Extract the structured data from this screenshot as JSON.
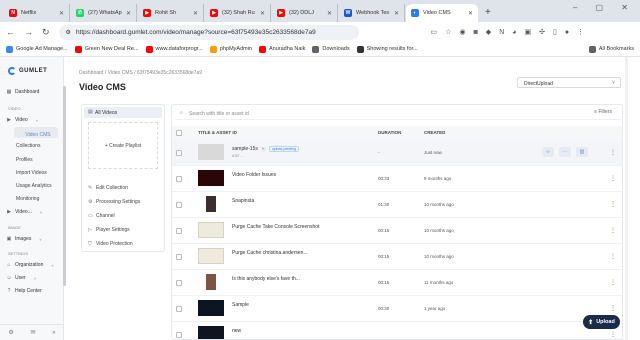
{
  "browser": {
    "tabs": [
      {
        "title": "Netflix",
        "fav_color": "#e50914",
        "glyph": "N"
      },
      {
        "title": "(27) WhatsAp",
        "fav_color": "#25d366",
        "glyph": "✆"
      },
      {
        "title": "Rohit Sh",
        "fav_color": "#ff0000",
        "glyph": "▶"
      },
      {
        "title": "(32) Shah Ru",
        "fav_color": "#ff0000",
        "glyph": "▶"
      },
      {
        "title": "(32) DDLJ",
        "fav_color": "#ff0000",
        "glyph": "▶"
      },
      {
        "title": "Webhook Tes",
        "fav_color": "#1a56db",
        "glyph": "W"
      },
      {
        "title": "Video CMS",
        "fav_color": "#2b7bf3",
        "glyph": "◐"
      }
    ],
    "new_tab": "+",
    "url": "https://dashboard.gumlet.com/video/manage?source=63f75493e35c2633568de7a9",
    "bookmarks": [
      {
        "label": "Google Ad Manage...",
        "fav_color": "#4285f4"
      },
      {
        "label": "Green New Deal Re...",
        "fav_color": "#ff0000"
      },
      {
        "label": "www.dataforprogr...",
        "fav_color": "#ff0000"
      },
      {
        "label": "phpMyAdmin",
        "fav_color": "#f89c0e"
      },
      {
        "label": "Anuradha Naik",
        "fav_color": "#ff0000"
      },
      {
        "label": "Downloads",
        "fav_color": "#5f6368"
      },
      {
        "label": "Showing results for...",
        "fav_color": "#333333"
      }
    ],
    "all_bookmarks": "All Bookmarks"
  },
  "sidebar": {
    "brand": "GUMLET",
    "dashboard": "Dashboard",
    "section_video": "VIDEO",
    "video": "Video",
    "video_sub": [
      "Video CMS",
      "Collections",
      "Profiles",
      "Import Videos",
      "Usage Analytics",
      "Monitoring"
    ],
    "video2": "Video...",
    "section_image": "IMAGE",
    "images": "Images",
    "section_settings": "SETTINGS",
    "organization": "Organization",
    "user": "User",
    "help": "Help Center"
  },
  "main": {
    "breadcrumb": "Dashboard / Video CMS / 63f75493e35c2633568de7a9",
    "title": "Video CMS",
    "source_select": "DirectUpload",
    "left_panel": {
      "all_videos": "All Videos",
      "create_playlist": "+ Create Playlist",
      "menu": [
        "Edit Collection",
        "Processing Settings",
        "Channel",
        "Player Settings",
        "Video Protection"
      ]
    },
    "search_placeholder": "Search with title or asset id",
    "filters": "Filters",
    "columns": {
      "title": "TITLE & ASSET ID",
      "duration": "DURATION",
      "created": "CREATED"
    },
    "rows": [
      {
        "title": "sample-15s",
        "sub": "63f7...",
        "duration": "-",
        "created": "Just now",
        "thumb": "#d9d9d9",
        "tag": "upload-pending",
        "hover": true
      },
      {
        "title": "Video Folder Issues",
        "sub": "",
        "duration": "00:33",
        "created": "9 months ago",
        "thumb": "#2a0606"
      },
      {
        "title": "Snapinsta",
        "sub": "",
        "duration": "01:30",
        "created": "10 months ago",
        "thumb": "#3a2f2f"
      },
      {
        "title": "Purge Cache Take Console Screenshot",
        "sub": "",
        "duration": "00:15",
        "created": "10 months ago",
        "thumb": "#eeeadc"
      },
      {
        "title": "Purge Cache christina.andersen...",
        "sub": "",
        "duration": "00:15",
        "created": "10 months ago",
        "thumb": "#eeeadc"
      },
      {
        "title": "Is this anybody else's fave th...",
        "sub": "",
        "duration": "00:15",
        "created": "11 months ago",
        "thumb": "#7a5548"
      },
      {
        "title": "Sample",
        "sub": "",
        "duration": "00:30",
        "created": "1 year ago",
        "thumb": "#0d1422"
      },
      {
        "title": "new",
        "sub": "",
        "duration": "",
        "created": "",
        "thumb": "#0d1422"
      }
    ],
    "upload_button": "Upload"
  }
}
